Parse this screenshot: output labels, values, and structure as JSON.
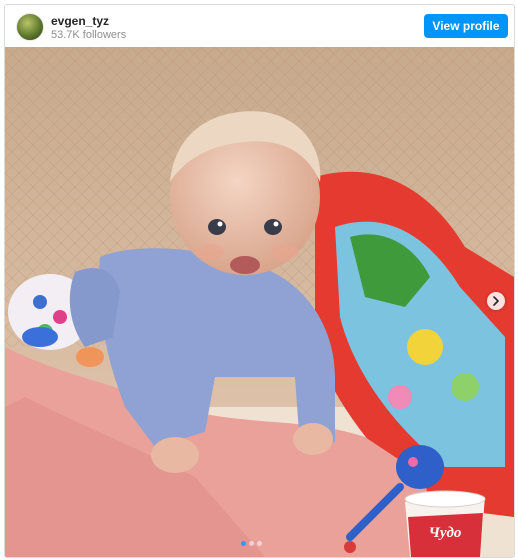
{
  "header": {
    "username": "evgen_tyz",
    "followers": "53.7K followers",
    "view_profile_label": "View profile"
  },
  "photo": {
    "yogurt_brand": "Чудо",
    "carousel": {
      "slide_count": 3,
      "active_index": 0
    }
  },
  "colors": {
    "button": "#0095f6",
    "active_dot": "#3897f0"
  }
}
